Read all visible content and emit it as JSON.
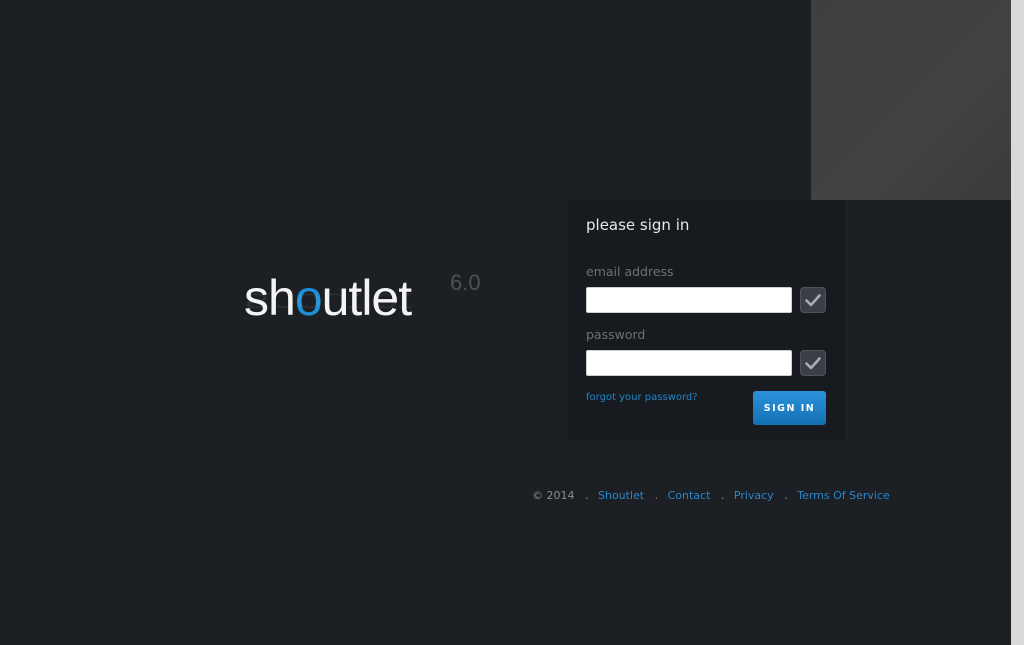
{
  "logo": {
    "text_before": "sh",
    "text_accent": "o",
    "text_after": "utlet",
    "version": "6.0",
    "accent_color": "#1e8fd6"
  },
  "signin": {
    "title": "please sign in",
    "email": {
      "label": "email address",
      "value": "",
      "placeholder": ""
    },
    "password": {
      "label": "password",
      "value": "",
      "placeholder": ""
    },
    "check_icon": "check-icon",
    "forgot_link": "forgot your password?",
    "button_label": "SIGN IN",
    "button_color": "#1e82c8"
  },
  "footer": {
    "copyright": "© 2014",
    "separator": ".",
    "links": [
      "Shoutlet",
      "Contact",
      "Privacy",
      "Terms Of Service"
    ],
    "link_color": "#2a86c8"
  }
}
